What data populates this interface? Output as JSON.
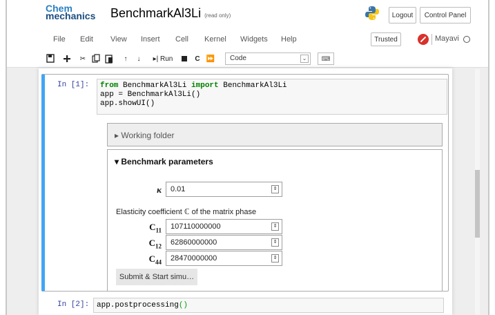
{
  "header": {
    "logo_line1": "Chem",
    "logo_line2": "mechanics",
    "notebook_title": "BenchmarkAl3Li",
    "readonly": "(read only)",
    "logout_label": "Logout",
    "control_panel_label": "Control Panel"
  },
  "menu": {
    "items": [
      "File",
      "Edit",
      "View",
      "Insert",
      "Cell",
      "Kernel",
      "Widgets",
      "Help"
    ],
    "trusted_label": "Trusted",
    "kernel_name": "Mayavi"
  },
  "toolbar": {
    "run_label": "Run",
    "cell_type": "Code"
  },
  "cells": [
    {
      "prompt": "In [1]:",
      "code_line1_kw1": "from",
      "code_line1_mod": " BenchmarkAl3Li ",
      "code_line1_kw2": "import",
      "code_line1_name": " BenchmarkAl3Li",
      "code_line2": "app = BenchmarkAl3Li()",
      "code_line3": "app.showUI()"
    },
    {
      "prompt": "In [2]:",
      "code_before": "app.postprocessing",
      "code_parens": "()"
    }
  ],
  "widgets": {
    "working_folder_title": "▸ Working folder",
    "benchmark_title": "▾ Benchmark parameters",
    "kappa_label": "κ",
    "kappa_value": "0.01",
    "elasticity_label": "Elasticity coefficient ℂ of the matrix phase",
    "c11_label": "C",
    "c11_sub": "11",
    "c11_value": "107110000000",
    "c12_label": "C",
    "c12_sub": "12",
    "c12_value": "62860000000",
    "c44_label": "C",
    "c44_sub": "44",
    "c44_value": "28470000000",
    "submit_label": "Submit & Start simu…"
  }
}
